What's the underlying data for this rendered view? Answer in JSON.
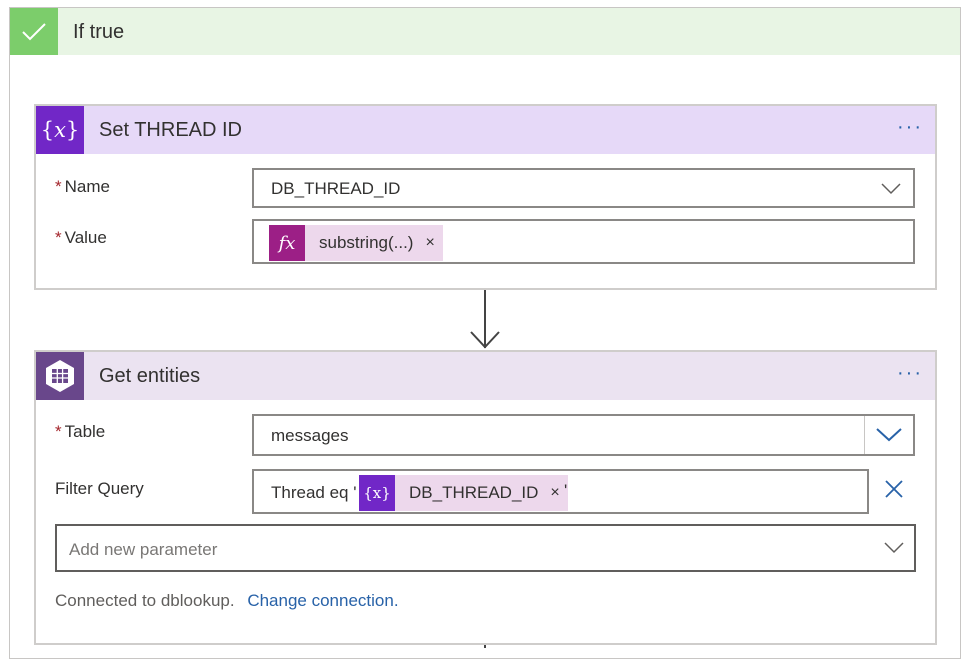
{
  "if_true": {
    "title": "If true"
  },
  "set_card": {
    "title": "Set THREAD ID",
    "more": "···",
    "icon": "variable-icon",
    "name_label": "Name",
    "name_value": "DB_THREAD_ID",
    "value_label": "Value",
    "value_token": {
      "icon": "fx-icon",
      "icon_text": "fx",
      "label": "substring(...)",
      "remove": "×"
    },
    "accent": "#7127c7",
    "header_bg": "#e6d9f8"
  },
  "get_card": {
    "title": "Get entities",
    "more": "···",
    "icon": "table-storage-icon",
    "table_label": "Table",
    "table_value": "messages",
    "filter_label": "Filter Query",
    "filter_prefix": "Thread eq '",
    "filter_token": {
      "icon": "variable-icon",
      "icon_text": "{x}",
      "label": "DB_THREAD_ID",
      "remove": "×"
    },
    "filter_suffix": "'",
    "add_param_placeholder": "Add new parameter",
    "connected_text": "Connected to dblookup.",
    "change_connection": "Change connection.",
    "accent": "#69478b",
    "header_bg": "#ebe3f1"
  },
  "required_mark": "*"
}
